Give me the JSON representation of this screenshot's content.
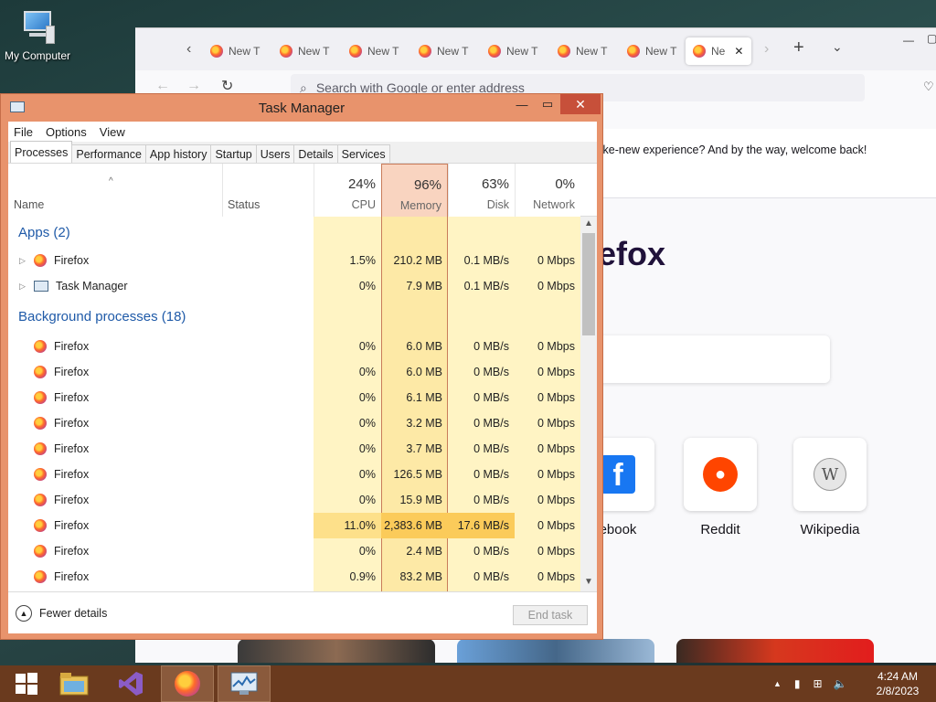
{
  "desktop": {
    "icon_label": "My Computer"
  },
  "firefox": {
    "tabs": [
      "New T",
      "New T",
      "New T",
      "New T",
      "New T",
      "New T",
      "New T",
      "Ne"
    ],
    "url_placeholder": "Search with Google or enter address",
    "notice": "like-new experience? And by the way, welcome back!",
    "logo_text": "efox",
    "shortcuts": [
      {
        "label": "ebook",
        "icon": "facebook-icon",
        "color": "#1877f2"
      },
      {
        "label": "Reddit",
        "icon": "reddit-icon",
        "color": "#ff4500"
      },
      {
        "label": "Wikipedia",
        "icon": "wikipedia-icon",
        "color": "#777777"
      }
    ]
  },
  "task_manager": {
    "title": "Task Manager",
    "menu": [
      "File",
      "Options",
      "View"
    ],
    "tabs": [
      "Processes",
      "Performance",
      "App history",
      "Startup",
      "Users",
      "Details",
      "Services"
    ],
    "active_tab": "Processes",
    "columns": {
      "name": "Name",
      "status": "Status",
      "cpu": {
        "pct": "24%",
        "label": "CPU"
      },
      "memory": {
        "pct": "96%",
        "label": "Memory"
      },
      "disk": {
        "pct": "63%",
        "label": "Disk"
      },
      "network": {
        "pct": "0%",
        "label": "Network"
      }
    },
    "apps_group": "Apps (2)",
    "apps": [
      {
        "name": "Firefox",
        "icon": "firefox-icon",
        "cpu": "1.5%",
        "memory": "210.2 MB",
        "disk": "0.1 MB/s",
        "network": "0 Mbps"
      },
      {
        "name": "Task Manager",
        "icon": "task-manager-icon",
        "cpu": "0%",
        "memory": "7.9 MB",
        "disk": "0.1 MB/s",
        "network": "0 Mbps"
      }
    ],
    "bg_group": "Background processes (18)",
    "background": [
      {
        "name": "Firefox",
        "cpu": "0%",
        "memory": "6.0 MB",
        "disk": "0 MB/s",
        "network": "0 Mbps"
      },
      {
        "name": "Firefox",
        "cpu": "0%",
        "memory": "6.0 MB",
        "disk": "0 MB/s",
        "network": "0 Mbps"
      },
      {
        "name": "Firefox",
        "cpu": "0%",
        "memory": "6.1 MB",
        "disk": "0 MB/s",
        "network": "0 Mbps"
      },
      {
        "name": "Firefox",
        "cpu": "0%",
        "memory": "3.2 MB",
        "disk": "0 MB/s",
        "network": "0 Mbps"
      },
      {
        "name": "Firefox",
        "cpu": "0%",
        "memory": "3.7 MB",
        "disk": "0 MB/s",
        "network": "0 Mbps"
      },
      {
        "name": "Firefox",
        "cpu": "0%",
        "memory": "126.5 MB",
        "disk": "0 MB/s",
        "network": "0 Mbps"
      },
      {
        "name": "Firefox",
        "cpu": "0%",
        "memory": "15.9 MB",
        "disk": "0 MB/s",
        "network": "0 Mbps"
      },
      {
        "name": "Firefox",
        "cpu": "11.0%",
        "memory": "2,383.6 MB",
        "disk": "17.6 MB/s",
        "network": "0 Mbps",
        "highlight": true
      },
      {
        "name": "Firefox",
        "cpu": "0%",
        "memory": "2.4 MB",
        "disk": "0 MB/s",
        "network": "0 Mbps"
      },
      {
        "name": "Firefox",
        "cpu": "0.9%",
        "memory": "83.2 MB",
        "disk": "0 MB/s",
        "network": "0 Mbps"
      }
    ],
    "fewer_details": "Fewer details",
    "end_task": "End task"
  },
  "taskbar": {
    "items": [
      "start-icon",
      "file-explorer-icon",
      "visual-studio-icon",
      "firefox-icon",
      "task-manager-icon"
    ],
    "time": "4:24 AM",
    "date": "2/8/2023"
  },
  "colors": {
    "tm_frame": "#e8936c",
    "memory_header": "#f9d4c0",
    "shade_light": "#fff4c4",
    "shade_mid": "#fde9a6",
    "shade_hot": "#fbcb5a",
    "taskbar": "#6a3a1e",
    "group_text": "#1f5aa8"
  }
}
